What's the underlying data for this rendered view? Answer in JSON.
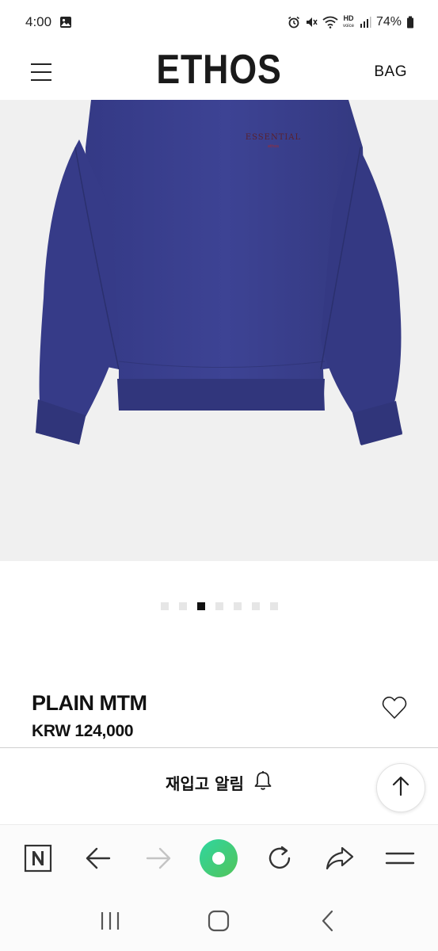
{
  "status_bar": {
    "time": "4:00",
    "battery": "74%",
    "icons": [
      "gallery-icon",
      "alarm-icon",
      "mute-icon",
      "wifi-icon",
      "hd-voice-icon",
      "signal-icon",
      "battery-icon"
    ]
  },
  "header": {
    "brand": "ETHOS",
    "bag_label": "BAG",
    "menu_icon": "hamburger-menu-icon"
  },
  "gallery": {
    "image_alt": "navy sweatshirt product photo",
    "slide_count": 7,
    "active_index": 2
  },
  "product": {
    "name": "PLAIN MTM",
    "price": "KRW 124,000",
    "wishlist_icon": "heart-outline-icon"
  },
  "restock": {
    "label": "재입고 알림",
    "icon": "bell-icon"
  },
  "scroll_top": {
    "icon": "arrow-up-icon"
  },
  "browser_toolbar": {
    "items": [
      "naver-home-icon",
      "back-arrow-icon",
      "forward-arrow-icon",
      "green-dot-icon",
      "refresh-icon",
      "share-icon",
      "menu-lines-icon"
    ]
  },
  "system_nav": {
    "items": [
      "recent-apps-icon",
      "home-icon",
      "back-chevron-icon"
    ]
  },
  "colors": {
    "image_bg": "#f0f0f0",
    "sweatshirt": "#3a3f8c",
    "active_dot": "#111111",
    "inactive_dot": "#e6e6e6",
    "green_button": "#3ccf86"
  }
}
